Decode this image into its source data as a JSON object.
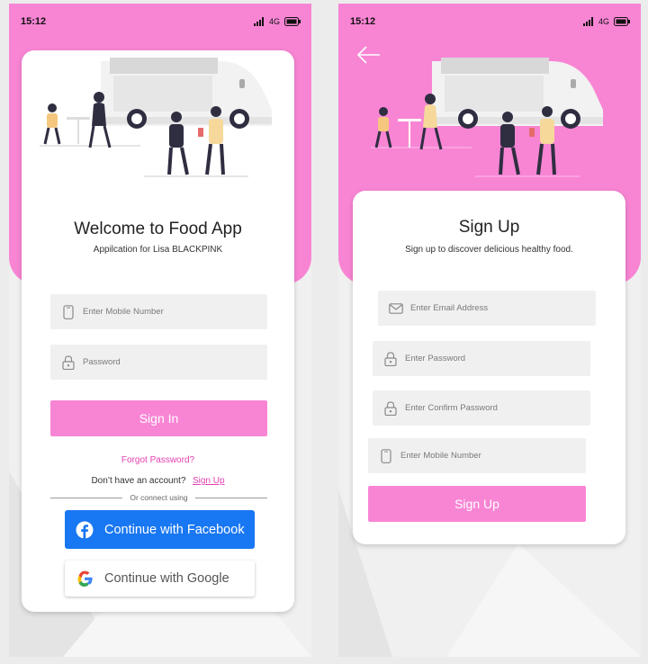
{
  "status_bar": {
    "time": "15:12",
    "network": "4G"
  },
  "signin": {
    "title": "Welcome to Food App",
    "subtitle": "Appilcation for Lisa BLACKPINK",
    "mobile_placeholder": "Enter Mobile Number",
    "password_placeholder": "Password",
    "signin_button": "Sign In",
    "forgot_password": "Forgot Password?",
    "no_account_text": "Don’t have an account?",
    "signup_link": "Sign Up",
    "connect_text": "Or connect using",
    "facebook_button": "Continue with Facebook",
    "google_button": "Continue with Google"
  },
  "signup": {
    "title": "Sign Up",
    "subtitle": "Sign up to discover delicious healthy food.",
    "email_placeholder": "Enter Email Address",
    "password_placeholder": "Enter Password",
    "confirm_password_placeholder": "Enter Confirm Password",
    "mobile_placeholder": "Enter Mobile Number",
    "signup_button": "Sign Up"
  },
  "colors": {
    "accent_pink": "#f885d4",
    "link_pink": "#e23fb1",
    "facebook_blue": "#1877f2"
  },
  "icons": [
    "signal-icon",
    "battery-icon",
    "back-arrow-icon",
    "phone-icon",
    "lock-icon",
    "mail-icon",
    "facebook-icon",
    "google-icon",
    "food-truck-illustration"
  ]
}
